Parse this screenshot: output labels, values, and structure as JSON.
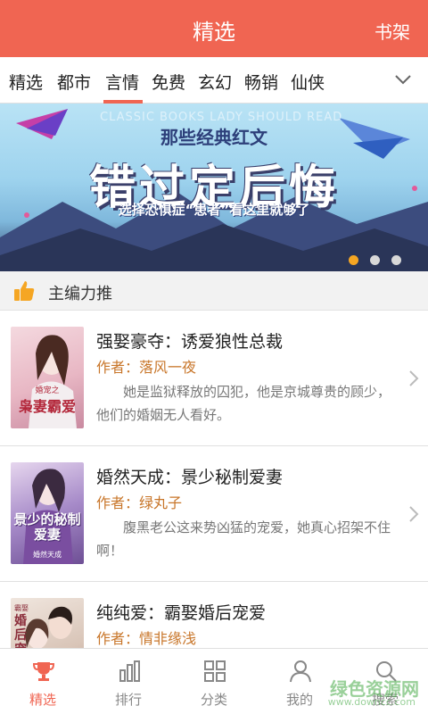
{
  "header": {
    "title": "精选",
    "shelf_label": "书架"
  },
  "tabs": [
    {
      "label": "精选"
    },
    {
      "label": "都市"
    },
    {
      "label": "言情"
    },
    {
      "label": "免费"
    },
    {
      "label": "玄幻"
    },
    {
      "label": "畅销"
    },
    {
      "label": "仙侠"
    }
  ],
  "active_tab": "言情",
  "banner": {
    "english": "CLASSIC BOOKS LADY SHOULD READ",
    "subtitle": "那些经典红文",
    "headline": "错过定后悔",
    "tagline": "选择恐惧症“患者”看这里就够了",
    "slide_count": 3,
    "active_slide": 1
  },
  "section": {
    "title": "主编力推"
  },
  "books": [
    {
      "title": "强娶豪夺：诱爱狼性总裁",
      "author": "作者：落风一夜",
      "desc": "她是监狱释放的囚犯，他是京城尊贵的顾少，他们的婚姻无人看好。",
      "cover_text": "枭妻霸爱",
      "cover_small": "婚宠之",
      "cover_color": "#e8b7c4"
    },
    {
      "title": "婚然天成：景少秘制爱妻",
      "author": "作者：绿丸子",
      "desc": "腹黑老公这来势凶猛的宠爱，她真心招架不住啊！",
      "cover_text": "景少的秘制爱妻",
      "cover_small": "婚然天成",
      "cover_color": "#a78bc9"
    },
    {
      "title": "纯纯爱：霸娶婚后宠爱",
      "author": "作者：情非缘浅",
      "desc": "",
      "cover_text": "婚后宠",
      "cover_small": "霸娶",
      "cover_color": "#d9c5b8"
    }
  ],
  "bottom_nav": [
    {
      "label": "精选",
      "icon": "trophy-icon",
      "active": true
    },
    {
      "label": "排行",
      "icon": "bar-chart-icon",
      "active": false
    },
    {
      "label": "分类",
      "icon": "grid-icon",
      "active": false
    },
    {
      "label": "我的",
      "icon": "user-icon",
      "active": false
    },
    {
      "label": "搜索",
      "icon": "search-icon",
      "active": false
    }
  ],
  "watermark": {
    "line1": "绿色资源网",
    "line2": "www.downcc.com"
  },
  "colors": {
    "accent": "#f06552",
    "author": "#c8762a",
    "active_dot": "#f5a623"
  }
}
